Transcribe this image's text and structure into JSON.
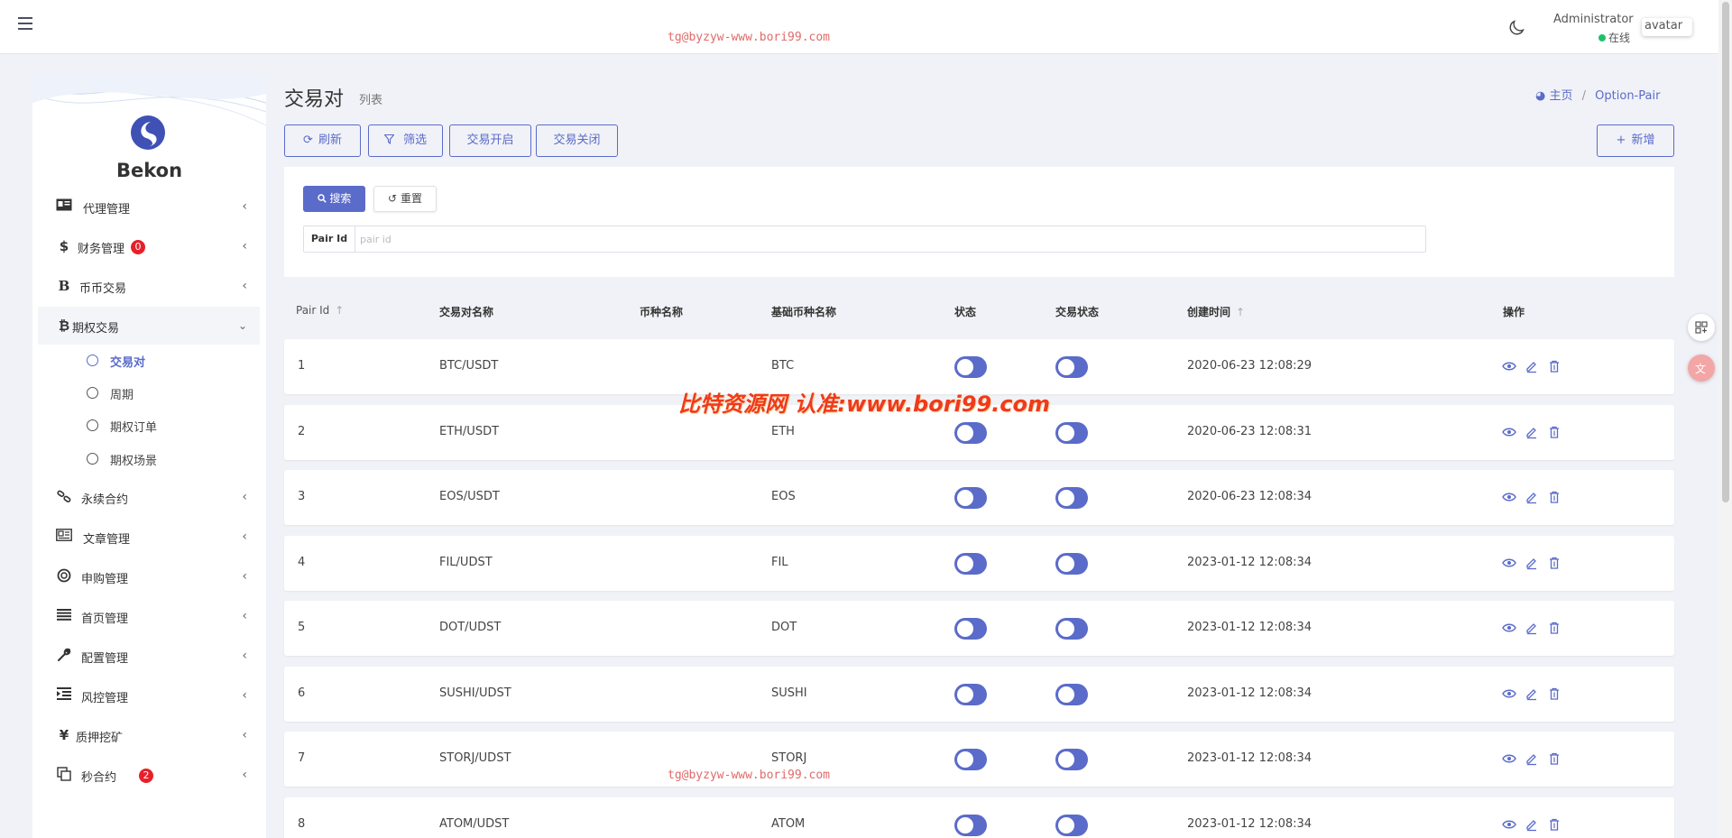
{
  "topbar": {
    "watermark": "tg@byzyw-www.bori99.com",
    "admin_name": "Administrator",
    "status": "在线",
    "avatar_alt": "avatar"
  },
  "sidebar": {
    "brand": "Bekon",
    "menu": [
      {
        "label": "代理管理",
        "icon": "id-card-icon"
      },
      {
        "label": "财务管理",
        "icon": "dollar-icon",
        "badge": "0"
      },
      {
        "label": "币币交易",
        "icon": "bitcoin-b-icon"
      },
      {
        "label": "期权交易",
        "icon": "bitcoin-icon",
        "expanded": true
      },
      {
        "label": "永续合约",
        "icon": "link-icon"
      },
      {
        "label": "文章管理",
        "icon": "newspaper-icon"
      },
      {
        "label": "申购管理",
        "icon": "life-ring-icon"
      },
      {
        "label": "首页管理",
        "icon": "list-icon"
      },
      {
        "label": "配置管理",
        "icon": "wrench-icon"
      },
      {
        "label": "风控管理",
        "icon": "indent-icon"
      },
      {
        "label": "质押挖矿",
        "icon": "yen-icon"
      },
      {
        "label": "秒合约",
        "icon": "copy-icon",
        "badge": "2"
      }
    ],
    "submenu": [
      {
        "label": "交易对",
        "active": true
      },
      {
        "label": "周期"
      },
      {
        "label": "期权订单"
      },
      {
        "label": "期权场景"
      }
    ]
  },
  "header": {
    "title": "交易对",
    "subtitle": "列表",
    "breadcrumb_home": "主页",
    "breadcrumb_current": "Option-Pair"
  },
  "toolbar": {
    "refresh": "刷新",
    "filter": "筛选",
    "open": "交易开启",
    "close": "交易关闭",
    "add": "新增"
  },
  "filter": {
    "search": "搜索",
    "reset": "重置",
    "field_label": "Pair Id",
    "field_placeholder": "pair id",
    "field_value": ""
  },
  "table": {
    "columns": [
      "Pair Id",
      "交易对名称",
      "币种名称",
      "基础币种名称",
      "状态",
      "交易状态",
      "创建时间",
      "操作"
    ],
    "rows": [
      {
        "id": "1",
        "pair": "BTC/USDT",
        "coin": "",
        "base": "BTC",
        "status": false,
        "trade": false,
        "created": "2020-06-23 12:08:29"
      },
      {
        "id": "2",
        "pair": "ETH/USDT",
        "coin": "",
        "base": "ETH",
        "status": false,
        "trade": false,
        "created": "2020-06-23 12:08:31"
      },
      {
        "id": "3",
        "pair": "EOS/USDT",
        "coin": "",
        "base": "EOS",
        "status": false,
        "trade": false,
        "created": "2020-06-23 12:08:34"
      },
      {
        "id": "4",
        "pair": "FIL/UDST",
        "coin": "",
        "base": "FIL",
        "status": false,
        "trade": false,
        "created": "2023-01-12 12:08:34"
      },
      {
        "id": "5",
        "pair": "DOT/UDST",
        "coin": "",
        "base": "DOT",
        "status": false,
        "trade": false,
        "created": "2023-01-12 12:08:34"
      },
      {
        "id": "6",
        "pair": "SUSHI/UDST",
        "coin": "",
        "base": "SUSHI",
        "status": false,
        "trade": false,
        "created": "2023-01-12 12:08:34"
      },
      {
        "id": "7",
        "pair": "STORJ/UDST",
        "coin": "",
        "base": "STORJ",
        "status": false,
        "trade": false,
        "created": "2023-01-12 12:08:34"
      },
      {
        "id": "8",
        "pair": "ATOM/UDST",
        "coin": "",
        "base": "ATOM",
        "status": false,
        "trade": false,
        "created": "2023-01-12 12:08:34"
      }
    ]
  },
  "overlay_watermark": "比特资源网 认准:www.bori99.com",
  "colors": {
    "accent": "#5a6bc9",
    "background": "#f1f2f7",
    "badge": "#e8202a",
    "online": "#20c06a"
  }
}
